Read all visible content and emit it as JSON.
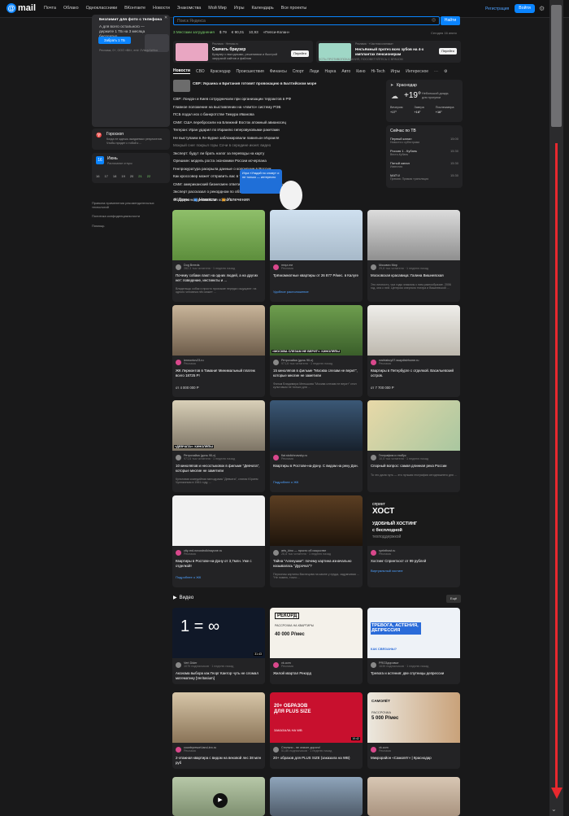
{
  "topbar": {
    "logo_text": "mail",
    "nav": [
      "Почта",
      "Облако",
      "Одноклассники",
      "ВКонтакте",
      "Новости",
      "Знакомства",
      "Мой Мир",
      "Игры",
      "Календарь",
      "Все проекты"
    ],
    "register": "Регистрация",
    "login": "Войти"
  },
  "popup": {
    "title": "Безлимит для фото с телефона",
    "text": "А для всего остального — держите 1 ТБ на 3 месяца бесплатно",
    "button": "Забрать 1 ТБ",
    "small": "Реклама, 0+, ООО «ВК», erid: 2VtzqvXzHxo"
  },
  "left": {
    "horoscope_title": "Гороскоп",
    "horoscope_text": "Когда не ждешь ожидаемых результатов. Чтобы придет с тобой к ...",
    "calendar_day": "16",
    "calendar_month": "Июнь",
    "calendar_sub": "Расписание отпуск",
    "calendar_days": [
      "16",
      "17",
      "18",
      "19",
      "20",
      "21",
      "22"
    ],
    "links": [
      "Правила применения рекомендательных технологий",
      "Политика конфиденциальности",
      "Помощь"
    ]
  },
  "search": {
    "placeholder": "Поиск Яндекса",
    "button": "Найти"
  },
  "strip": {
    "items": [
      "3 Местами затруднения",
      "$ 79",
      "€ 90,01",
      "10,93",
      "«Пепси-Колан»"
    ],
    "date": "Сегодня 16 июня"
  },
  "ads": [
    {
      "title": "Скачать браузер",
      "text": "Браузер с выгодными, решениями и быстрой загрузкой сайтов и файлов",
      "button": "Перейти",
      "label": "Реклама · Нетмас.ru"
    },
    {
      "title": "Несъёмный протез всех зубов на 4-х имплантах пенсионерам",
      "text": "ЕСТЬ ПРОТИВОПОКАЗАНИЯ, ПОСОВЕТУЙТЕСЬ С ВРАЧОМ",
      "button": "Перейти",
      "label": "Реклама · «Частная клиника»"
    }
  ],
  "tabs": [
    "Новости",
    "СВО",
    "Краснодар",
    "Происшествия",
    "Финансы",
    "Спорт",
    "Леди",
    "Наука",
    "Авто",
    "Кино",
    "Hi-Tech",
    "Игры",
    "Интересное"
  ],
  "news": [
    "СВР: Украина и Британия готовят провокацию в Балтийском море",
    "СВР: Лондон и Киев сотрудничали при организации террактов в РФ",
    "Главное положение на выставлении на «Авито» систему РЭБ",
    "ПСБ подал иск о банкротстве Тимура Иванова",
    "СМИ: США перебросили на Ближний Восток атомный авианосец",
    "Тегеран: Иран ударил по Израилю гиперзвуковыми ракетами",
    "Не выступаем в Ле-Бурже заблокировали павильон Израиля",
    "Мокрый снег покрыл горы Сочи в середине июня: видео",
    "Эксперт: будут ли брать налог за переводы на карту",
    "Орешкин: модель роста экономики России исчерпана",
    "Генпрокуратура раскрыла данные о коррупции в России",
    "Как кроссовер может отправить вас в тюрьму",
    "СМИ: американский бизнесмен ответил на вопросы «Восток-2»",
    "Эксперт рассказал о рекордном по объему ремонте",
    "Обнаружена древнейшая копия ..."
  ],
  "tooltip": "Игра «Угадай по слову» и не только — интересно",
  "weather": {
    "city": "Краснодар",
    "temp": "+19°",
    "desc": "Небольшой дождь",
    "sub": "для прогулки",
    "forecast": [
      {
        "label": "Вечером",
        "temp": "+17°"
      },
      {
        "label": "Завтра",
        "temp": "+16°"
      },
      {
        "label": "Послезавтра",
        "temp": "+16°"
      }
    ]
  },
  "tv": {
    "title": "Сейчас по ТВ",
    "channels": [
      {
        "name": "Первый канал",
        "show": "Новости с субтитрами",
        "time": "15:00"
      },
      {
        "name": "Россия 1 - Кубань",
        "show": "Вести-Кубань",
        "time": "15:30"
      },
      {
        "name": "Пятый канал",
        "show": "Известия",
        "time": "15:30"
      },
      {
        "name": "МАТЧ!",
        "show": "Премия. Прямая трансляция",
        "time": "15:30"
      }
    ]
  },
  "feed_tabs": [
    "Дзен",
    "Новости",
    "Увлечения"
  ],
  "tiles": [
    {
      "source": "Dog Breeds",
      "meta": "282,3 тыс читателя · 1 неделю назад",
      "title": "Почему собаки лают на одних людей, а на других нет: поведение, инстинкты и ...",
      "extra": "Владельцы собак и просто прохожие нередко ощущают: на одного человека пёс может ...",
      "link": "",
      "price": ""
    },
    {
      "source": "mrqz.me",
      "meta": "Реклама",
      "title": "Трёхкомнатные квартиры от 26 877 Р/мес. в Калуге",
      "extra": "",
      "link": "Удобное расположение",
      "price": ""
    },
    {
      "source": "Москвич Мир",
      "meta": "29,8 тыс читателя · 1 неделю назад",
      "title": "Московская красавица: Галина Вишневская",
      "extra": "Это личность, чьи годы знакомы с ним разнообразие. 2006 год, она с ней. Центром оперного театра и Вишневской ...",
      "link": "",
      "price": ""
    },
    {
      "source": "lermontov23.ru",
      "meta": "Реклама",
      "title": "ЖК Лермонтов в Тамани! Минимальный платеж всего 18725 Р!",
      "extra": "",
      "link": "",
      "price": "от 4 000 000 Р"
    },
    {
      "source": "Ретрочайка (дочь 90-х)",
      "meta": "971,6 тыс читателя · 1 неделю назад",
      "title": "15 киноляпов в фильме \"Москва слезам не верит\", которые многие не заметили",
      "extra": "Фильм Владимира Меньшова \"Москва слезам не верит\" стал культовым не только для ...",
      "link": "",
      "price": ""
    },
    {
      "source": "roshtabuy07.ssaydistrhome.ru",
      "meta": "Реклама",
      "title": "Квартиры в Петербурге с отделкой. Васильевский остров.",
      "extra": "",
      "link": "",
      "price": "от 7 700 000 Р"
    },
    {
      "source": "Ретрочайка (дочь 90-х)",
      "meta": "971,6 тыс читателя · 1 неделю назад",
      "title": "10 киноляпов и несостыковок в фильме \"Девчата\", которые многие не заметили",
      "extra": "Культовая комедийная мелодрама \"Девчата\", снятая Юрием Чулюкиным в 1961 году, ...",
      "link": "",
      "price": ""
    },
    {
      "source": "flat.stolichnavsky.ru",
      "meta": "Реклама",
      "title": "Квартиры в Ростове-на-Дону. С видом на реку Дон.",
      "extra": "",
      "link": "Подробнее о ЖК",
      "price": ""
    },
    {
      "source": "География и глобус",
      "meta": "10,5 тыс читателя · 1 неделю назад",
      "title": "Спорный вопрос: самая длинная река России",
      "extra": "То что дала чуть — это лучшая география сегодняшнего дня ...",
      "link": "",
      "price": ""
    },
    {
      "source": "city-rnd.novostroikinayone.ru",
      "meta": "Реклама",
      "title": "Квартиры в Ростове-на-Дону от 3,7млн. Уже с отделкой!",
      "extra": "",
      "link": "Подробнее о ЖК",
      "price": ""
    },
    {
      "source": "arts_kino — просто об искусстве",
      "meta": "26,8 тыс читателя · 1 неделю назад",
      "title": "Тайна \"Аленушки\": почему картина изначально называлась \"Дурочка\"?",
      "extra": "Персонаж картины Васнецова на камне у пруда, задумчивая ... \"Не помню, точно ...",
      "link": "",
      "price": ""
    },
    {
      "source": "sprinthost.ru",
      "meta": "Реклама",
      "title": "Хостинг Спринтхост от 99 рублей",
      "extra": "",
      "link": "Виртуальный хостинг",
      "price": ""
    }
  ],
  "hosting_ad": {
    "brand1": "спринт",
    "brand2": "ХОСТ",
    "line1": "УДОБНЫЙ ХОСТИНГ",
    "line2": "с бесплодной",
    "line3": "техподдержкой"
  },
  "formula": "1 = ∞",
  "video": {
    "heading": "Видео",
    "more": "Ещё",
    "items": [
      {
        "source": "Vert Dider",
        "meta": "107К подписчиков · 1 неделю назад",
        "title": "Аксиома выбора как Георг Кантор чуть не сломал математику [Veritasium]",
        "duration": "31:43"
      },
      {
        "source": "vk.com",
        "meta": "Реклама",
        "title": "Жилой квартал Рекорд",
        "duration": ""
      },
      {
        "source": "PROЗдоровье",
        "meta": "163К подписчиков · 1 неделю назад",
        "title": "Тревога и астения: две спутницы депрессии",
        "duration": ""
      },
      {
        "source": "countryresort.land-inn.ru",
        "meta": "Реклама",
        "title": "2-этажная квартира с видом на вековой лес 38 млн руб",
        "duration": ""
      },
      {
        "source": "Стильно - не значит дорого!",
        "meta": "51,8К подписчиков · 1 неделю назад",
        "title": "20+ образов для PLUS SIZE (заказала на WB)",
        "duration": "10:42"
      },
      {
        "source": "vk.com",
        "meta": "Реклама",
        "title": "Микрорайон «Самолёт» | Краснодар",
        "duration": ""
      }
    ]
  },
  "video_overlays": {
    "rekord": "РЕКОРД",
    "rekord_sub": "РАССРОЧКА НА КВАРТИРЫ",
    "rekord_price": "40 000 Р/мес",
    "anxiety": "ТРЕВОГА, АСТЕНИЯ, ДЕПРЕССИЯ",
    "anxiety_sub": "КАК СВЯЗАНЫ?",
    "plus": "20+ ОБРАЗОВ ДЛЯ PLUS SIZE",
    "plus_sub": "ЗАКАЗАЛА НА WB",
    "samolet": "САМОЛЁТ",
    "samolet_sub": "РАССРОЧКА",
    "samolet_price": "5 000 Р/мес",
    "devchata": "«ДЕВЧАТА»: КИНОЛЯПЫ",
    "moscow": "«МОСКВА СЛЕЗАМ НЕ ВЕРИТ»: КИНОЛЯПЫ"
  },
  "colors": {
    "bg": "#19191a",
    "card": "#232325",
    "accent": "#0a84ff",
    "link": "#4ea1ff",
    "scroll_marker": "#e8282e"
  }
}
